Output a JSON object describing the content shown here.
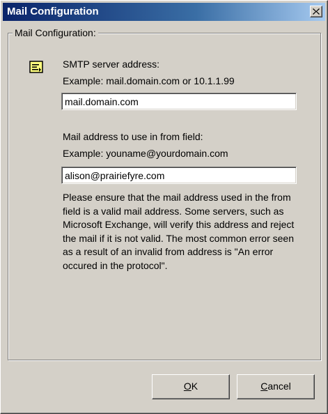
{
  "window": {
    "title": "Mail Configuration"
  },
  "group": {
    "legend": "Mail Configuration:"
  },
  "icons": {
    "note": "note-icon",
    "close": "close-icon"
  },
  "smtp": {
    "label": "SMTP server address:",
    "example": "Example: mail.domain.com or 10.1.1.99",
    "value": "mail.domain.com"
  },
  "from": {
    "label": "Mail address to use in from field:",
    "example": "Example: youname@yourdomain.com",
    "value": "alison@prairiefyre.com"
  },
  "warning": {
    "text": "Please ensure that the mail address used in the from field is a valid mail address.  Some servers, such as Microsoft Exchange, will verify this address and reject the mail if it is not valid.  The most common error seen as a result of an invalid from address is  \"An error occured in the protocol\"."
  },
  "buttons": {
    "ok": {
      "mnemonic": "O",
      "rest": "K"
    },
    "cancel": {
      "mnemonic": "C",
      "rest": "ancel"
    }
  },
  "colors": {
    "titlebar_start": "#0a246a",
    "titlebar_end": "#a6caf0",
    "face": "#d4d0c8"
  }
}
